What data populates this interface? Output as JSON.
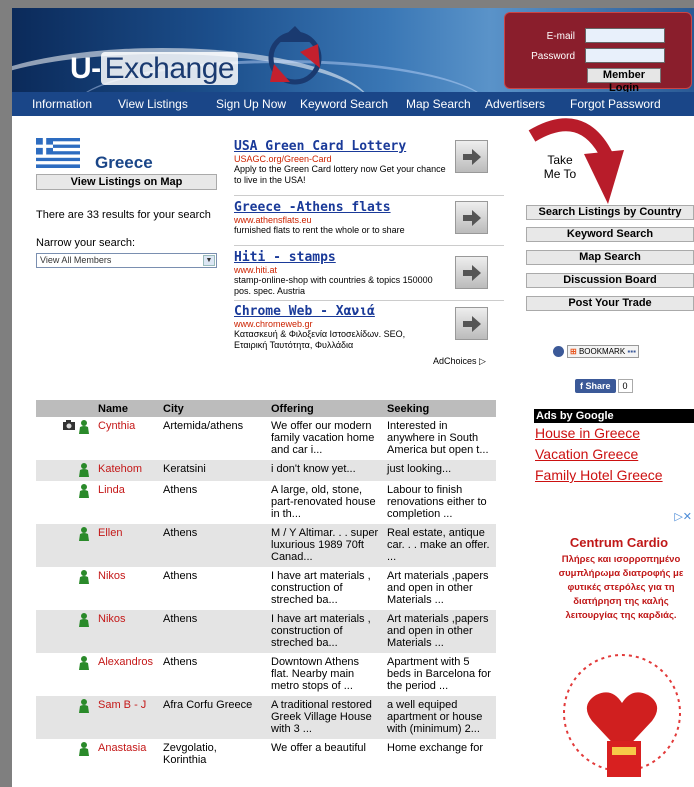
{
  "header": {
    "logo_u": "U-",
    "logo_exchange": "Exchange",
    "login": {
      "email_label": "E-mail",
      "password_label": "Password",
      "button": "Member Login"
    }
  },
  "nav": [
    "Information",
    "View Listings",
    "Sign Up Now",
    "Keyword Search",
    "Map Search",
    "Advertisers",
    "Forgot Password"
  ],
  "left": {
    "country": "Greece",
    "view_map_button": "View Listings on Map",
    "results_text": "There are 33 results for your search",
    "narrow_label": "Narrow your search:",
    "select_value": "View All Members"
  },
  "ads": [
    {
      "title": "USA Green Card Lottery",
      "url": "USAGC.org/Green-Card",
      "desc": "Apply to the Green Card lottery now Get your chance to live in the USA!"
    },
    {
      "title": "Greece -Athens flats",
      "url": "www.athensflats.eu",
      "desc": "furnished flats to rent the whole or to share"
    },
    {
      "title": "Hiti - stamps",
      "url": "www.hiti.at",
      "desc": "stamp-online-shop with countries & topics 150000 pos. spec. Austria"
    },
    {
      "title": "Chrome Web - Χανιά",
      "url": "www.chromeweb.gr",
      "desc": "Κατασκευή & Φιλοξενία Ιστοσελίδων. SEO, Εταιρική Ταυτότητα, Φυλλάδια"
    }
  ],
  "adchoices": "AdChoices",
  "right": {
    "take_me_to": "Take Me To",
    "buttons": [
      "Search Listings by Country",
      "Keyword Search",
      "Map Search",
      "Discussion Board",
      "Post Your Trade"
    ],
    "bookmark": "BOOKMARK",
    "share_label": "Share",
    "share_count": "0",
    "ads_by_google": "Ads by Google",
    "google_ads": [
      "House in Greece",
      "Vacation Greece",
      "Family Hotel Greece"
    ],
    "banner_title": "Centrum Cardio",
    "banner_text": "Πλήρες και ισορροπημένο συμπλήρωμα διατροφής με φυτικές στερόλες για τη διατήρηση της καλής λειτουργίας της καρδιάς."
  },
  "table": {
    "headers": [
      "Name",
      "City",
      "Offering",
      "Seeking"
    ],
    "rows": [
      {
        "name": "Cynthia",
        "city": "Artemida/athens",
        "offering": "We offer our modern family vacation home and car i...",
        "seeking": "Interested in anywhere in South America but open t..."
      },
      {
        "name": "Katehom",
        "city": "Keratsini",
        "offering": "i don't know yet...",
        "seeking": "just looking..."
      },
      {
        "name": "Linda",
        "city": "Athens",
        "offering": "A large, old, stone, part-renovated house in th...",
        "seeking": "Labour to finish renovations either to completion ..."
      },
      {
        "name": "Ellen",
        "city": "Athens",
        "offering": "M / Y Altimar. . . super luxurious 1989 70ft Canad...",
        "seeking": "Real estate, antique car. . . make an offer. ..."
      },
      {
        "name": "Nikos",
        "city": "Athens",
        "offering": "I have art materials , construction of streched ba...",
        "seeking": "Art materials ,papers and open in other Materials ..."
      },
      {
        "name": "Nikos",
        "city": "Athens",
        "offering": "I have art materials , construction of streched ba...",
        "seeking": "Art materials ,papers and open in other Materials ..."
      },
      {
        "name": "Alexandros",
        "city": "Athens",
        "offering": "Downtown Athens flat. Nearby main metro stops of ...",
        "seeking": "Apartment with 5 beds in Barcelona for the period ..."
      },
      {
        "name": "Sam B - J",
        "city": "Afra Corfu Greece",
        "offering": "A traditional restored Greek Village House with 3 ...",
        "seeking": "a well equiped apartment or house with (minimum) 2..."
      },
      {
        "name": "Anastasia",
        "city": "Zevgolatio, Korinthia",
        "offering": "We offer a beautiful",
        "seeking": "Home exchange for"
      }
    ]
  }
}
